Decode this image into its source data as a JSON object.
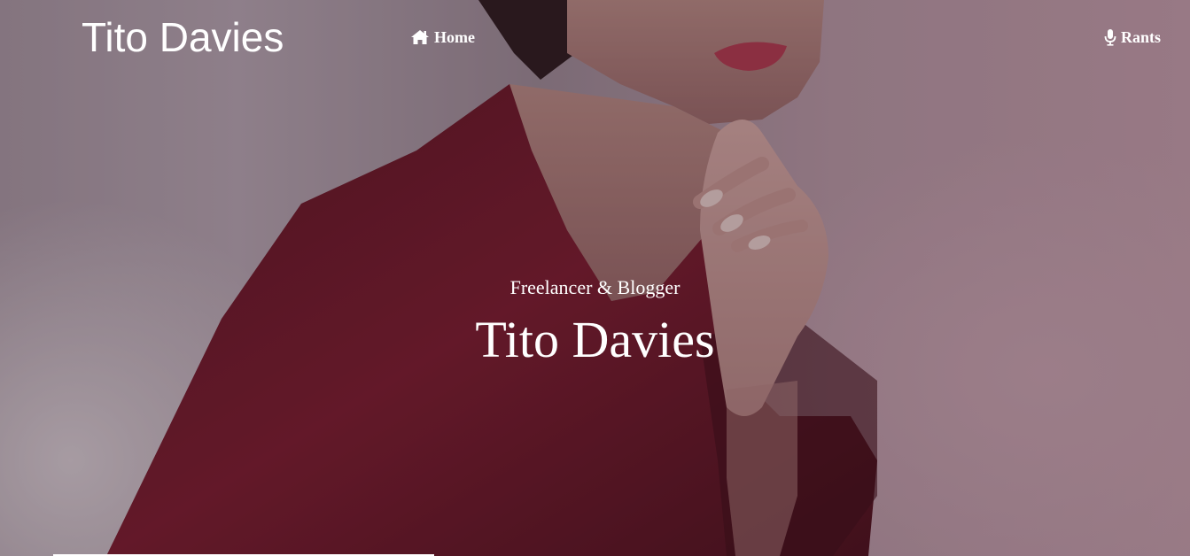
{
  "header": {
    "brand": "Tito Davies",
    "nav": {
      "home_label": "Home",
      "home_icon": "home-icon",
      "rants_label": "Rants",
      "rants_icon": "microphone-icon"
    }
  },
  "hero": {
    "tagline": "Freelancer & Blogger",
    "title": "Tito Davies"
  },
  "colors": {
    "text": "#ffffff",
    "garment": "#6b1526",
    "background": "#b29fad"
  }
}
